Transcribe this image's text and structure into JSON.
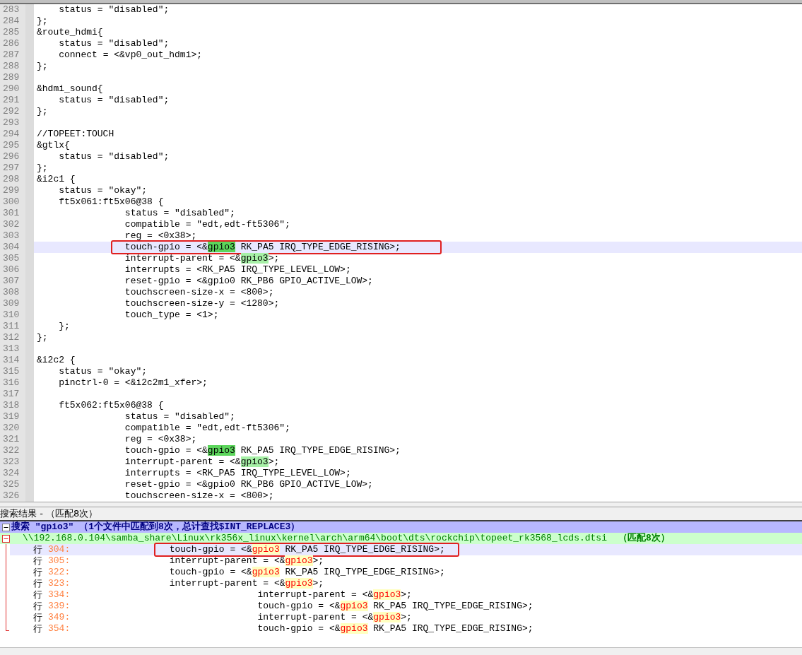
{
  "editor": {
    "lines": [
      {
        "number": "283",
        "text": "    status = \"disabled\";",
        "current": false,
        "boxed": false
      },
      {
        "number": "284",
        "text": "};",
        "current": false,
        "boxed": false
      },
      {
        "number": "285",
        "text": "&route_hdmi{",
        "current": false,
        "boxed": false
      },
      {
        "number": "286",
        "text": "    status = \"disabled\";",
        "current": false,
        "boxed": false
      },
      {
        "number": "287",
        "text": "    connect = <&vp0_out_hdmi>;",
        "current": false,
        "boxed": false
      },
      {
        "number": "288",
        "text": "};",
        "current": false,
        "boxed": false
      },
      {
        "number": "289",
        "current": false
      },
      {
        "number": "290",
        "text": "&hdmi_sound{",
        "current": false,
        "boxed": false
      },
      {
        "number": "291",
        "text": "    status = \"disabled\";",
        "current": false,
        "boxed": false
      },
      {
        "number": "292",
        "text": "};",
        "current": false,
        "boxed": false
      },
      {
        "number": "293",
        "current": false
      },
      {
        "number": "294",
        "text": "//TOPEET:TOUCH",
        "current": false,
        "boxed": false
      },
      {
        "number": "295",
        "text": "&gtlx{",
        "current": false,
        "boxed": false
      },
      {
        "number": "296",
        "text": "    status = \"disabled\";",
        "current": false,
        "boxed": false
      },
      {
        "number": "297",
        "text": "};",
        "current": false,
        "boxed": false
      },
      {
        "number": "298",
        "text": "&i2c1 {",
        "current": false,
        "boxed": false
      },
      {
        "number": "299",
        "text": "    status = \"okay\";",
        "current": false,
        "boxed": false
      },
      {
        "number": "300",
        "text": "    ft5x061:ft5x06@38 {",
        "current": false,
        "boxed": false
      },
      {
        "number": "301",
        "text": "                status = \"disabled\";",
        "current": false,
        "boxed": false
      },
      {
        "number": "302",
        "text": "                compatible = \"edt,edt-ft5306\";",
        "current": false,
        "boxed": false
      },
      {
        "number": "303",
        "text": "                reg = <0x38>;",
        "current": false,
        "boxed": false
      },
      {
        "number": "304",
        "text": "                touch-gpio = <&",
        "match": "gpio3",
        "match_strong": true,
        "after": " RK_PA5 IRQ_TYPE_EDGE_RISING>;",
        "current": true,
        "boxed": true
      },
      {
        "number": "305",
        "text": "                interrupt-parent = <&",
        "match": "gpio3",
        "match_strong": false,
        "after": ">;",
        "current": false,
        "boxed": false
      },
      {
        "number": "306",
        "text": "                interrupts = <RK_PA5 IRQ_TYPE_LEVEL_LOW>;",
        "current": false,
        "boxed": false
      },
      {
        "number": "307",
        "text": "                reset-gpio = <&gpio0 RK_PB6 GPIO_ACTIVE_LOW>;",
        "current": false,
        "boxed": false
      },
      {
        "number": "308",
        "text": "                touchscreen-size-x = <800>;",
        "current": false,
        "boxed": false
      },
      {
        "number": "309",
        "text": "                touchscreen-size-y = <1280>;",
        "current": false,
        "boxed": false
      },
      {
        "number": "310",
        "text": "                touch_type = <1>;",
        "current": false,
        "boxed": false
      },
      {
        "number": "311",
        "text": "    };",
        "current": false,
        "boxed": false
      },
      {
        "number": "312",
        "text": "};",
        "current": false,
        "boxed": false
      },
      {
        "number": "313",
        "current": false
      },
      {
        "number": "314",
        "text": "&i2c2 {",
        "current": false,
        "boxed": false
      },
      {
        "number": "315",
        "text": "    status = \"okay\";",
        "current": false,
        "boxed": false
      },
      {
        "number": "316",
        "text": "    pinctrl-0 = <&i2c2m1_xfer>;",
        "current": false,
        "boxed": false
      },
      {
        "number": "317",
        "current": false
      },
      {
        "number": "318",
        "text": "    ft5x062:ft5x06@38 {",
        "current": false,
        "boxed": false
      },
      {
        "number": "319",
        "text": "                status = \"disabled\";",
        "current": false,
        "boxed": false
      },
      {
        "number": "320",
        "text": "                compatible = \"edt,edt-ft5306\";",
        "current": false,
        "boxed": false
      },
      {
        "number": "321",
        "text": "                reg = <0x38>;",
        "current": false,
        "boxed": false
      },
      {
        "number": "322",
        "text": "                touch-gpio = <&",
        "match": "gpio3",
        "match_strong": true,
        "after": " RK_PA5 IRQ_TYPE_EDGE_RISING>;",
        "current": false,
        "boxed": false
      },
      {
        "number": "323",
        "text": "                interrupt-parent = <&",
        "match": "gpio3",
        "match_strong": false,
        "after": ">;",
        "current": false,
        "boxed": false
      },
      {
        "number": "324",
        "text": "                interrupts = <RK_PA5 IRQ_TYPE_LEVEL_LOW>;",
        "current": false,
        "boxed": false
      },
      {
        "number": "325",
        "text": "                reset-gpio = <&gpio0 RK_PB6 GPIO_ACTIVE_LOW>;",
        "current": false,
        "boxed": false
      },
      {
        "number": "326",
        "text": "                touchscreen-size-x = <800>;",
        "current": false,
        "boxed": false
      }
    ]
  },
  "results_panel": {
    "title": "搜索结果 - （匹配8次）",
    "search": {
      "text": "搜索 \"gpio3\" （1个文件中匹配到8次，总计查找$INT_REPLACE3）",
      "expanded": true
    },
    "file": {
      "path": "\\\\192.168.0.104\\samba_share\\Linux\\rk356x_linux\\kernel\\arch\\arm64\\boot\\dts\\rockchip\\topeet_rk3568_lcds.dtsi",
      "count": "（匹配8次）",
      "expanded": true
    },
    "rows": [
      {
        "label": "行",
        "number": "304:",
        "text": "                  touch-gpio = <&",
        "match": "gpio3",
        "after": " RK_PA5 IRQ_TYPE_EDGE_RISING>;",
        "current": true,
        "boxed": true
      },
      {
        "label": "行",
        "number": "305:",
        "text": "                  interrupt-parent = <&",
        "match": "gpio3",
        "after": ">;",
        "current": false,
        "boxed": false
      },
      {
        "label": "行",
        "number": "322:",
        "text": "                  touch-gpio = <&",
        "match": "gpio3",
        "after": " RK_PA5 IRQ_TYPE_EDGE_RISING>;",
        "current": false,
        "boxed": false
      },
      {
        "label": "行",
        "number": "323:",
        "text": "                  interrupt-parent = <&",
        "match": "gpio3",
        "after": ">;",
        "current": false,
        "boxed": false
      },
      {
        "label": "行",
        "number": "334:",
        "text": "                                  interrupt-parent = <&",
        "match": "gpio3",
        "after": ">;",
        "current": false,
        "boxed": false
      },
      {
        "label": "行",
        "number": "339:",
        "text": "                                  touch-gpio = <&",
        "match": "gpio3",
        "after": " RK_PA5 IRQ_TYPE_EDGE_RISING>;",
        "current": false,
        "boxed": false
      },
      {
        "label": "行",
        "number": "349:",
        "text": "                                  interrupt-parent = <&",
        "match": "gpio3",
        "after": ">;",
        "current": false,
        "boxed": false
      },
      {
        "label": "行",
        "number": "354:",
        "text": "                                  touch-gpio = <&",
        "match": "gpio3",
        "after": " RK_PA5 IRQ_TYPE_EDGE_RISING>;",
        "current": false,
        "boxed": false
      }
    ]
  }
}
